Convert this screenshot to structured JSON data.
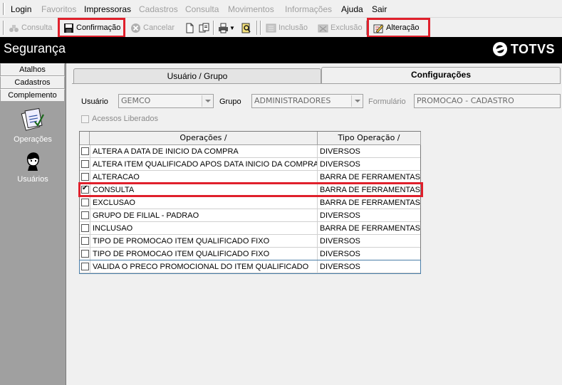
{
  "menubar": {
    "items": [
      {
        "label": "Login",
        "enabled": true
      },
      {
        "label": "Favoritos",
        "enabled": false
      },
      {
        "label": "Impressoras",
        "enabled": true
      },
      {
        "label": "Cadastros",
        "enabled": false
      },
      {
        "label": "Consulta",
        "enabled": false
      },
      {
        "label": "Movimentos",
        "enabled": false
      },
      {
        "label": "Informações",
        "enabled": false
      },
      {
        "label": "Ajuda",
        "enabled": true
      },
      {
        "label": "Sair",
        "enabled": true
      }
    ]
  },
  "toolbar": {
    "consulta_label": "Consulta",
    "confirmacao_label": "Confirmação",
    "cancelar_label": "Cancelar",
    "inclusao_label": "Inclusão",
    "exclusao_label": "Exclusão",
    "alteracao_label": "Alteração"
  },
  "window": {
    "title": "Segurança",
    "logo_text": "TOTVS"
  },
  "sidebar": {
    "tabs": [
      {
        "label": "Atalhos"
      },
      {
        "label": "Cadastros"
      },
      {
        "label": "Complemento"
      }
    ],
    "shortcuts": [
      {
        "label": "Operações",
        "icon": "clipboard-check-icon"
      },
      {
        "label": "Usuários",
        "icon": "user-icon"
      }
    ]
  },
  "tabs": [
    {
      "label": "Usuário  / Grupo",
      "active": false
    },
    {
      "label": "Configurações",
      "active": true
    }
  ],
  "form": {
    "usuario_label": "Usuário",
    "usuario_value": "GEMCO",
    "grupo_label": "Grupo",
    "grupo_value": "ADMINISTRADORES",
    "formulario_label": "Formulário",
    "formulario_value": "PROMOCAO - CADASTRO",
    "acessos_label": "Acessos Liberados"
  },
  "grid": {
    "columns": [
      "Operações  /",
      "Tipo Operação  /"
    ],
    "rows": [
      {
        "checked": false,
        "operacao": "ALTERA A DATA DE INICIO DA COMPRA",
        "tipo": "DIVERSOS"
      },
      {
        "checked": false,
        "operacao": "ALTERA ITEM QUALIFICADO APOS DATA INICIO DA COMPRA",
        "tipo": "DIVERSOS"
      },
      {
        "checked": false,
        "operacao": "ALTERACAO",
        "tipo": "BARRA DE FERRAMENTAS"
      },
      {
        "checked": true,
        "operacao": "CONSULTA",
        "tipo": "BARRA DE FERRAMENTAS"
      },
      {
        "checked": false,
        "operacao": "EXCLUSAO",
        "tipo": "BARRA DE FERRAMENTAS"
      },
      {
        "checked": false,
        "operacao": "GRUPO DE FILIAL - PADRAO",
        "tipo": "DIVERSOS"
      },
      {
        "checked": false,
        "operacao": "INCLUSAO",
        "tipo": "BARRA DE FERRAMENTAS"
      },
      {
        "checked": false,
        "operacao": "TIPO DE PROMOCAO ITEM QUALIFICADO FIXO",
        "tipo": "DIVERSOS"
      },
      {
        "checked": false,
        "operacao": "TIPO DE PROMOCAO ITEM QUALIFICADO FIXO",
        "tipo": "DIVERSOS"
      },
      {
        "checked": false,
        "operacao": "VALIDA O PRECO PROMOCIONAL DO ITEM QUALIFICADO",
        "tipo": "DIVERSOS"
      }
    ]
  },
  "colors": {
    "highlight": "#e0202c",
    "titlebar_bg": "#000000",
    "sidebar_bg": "#a0a0a0"
  }
}
